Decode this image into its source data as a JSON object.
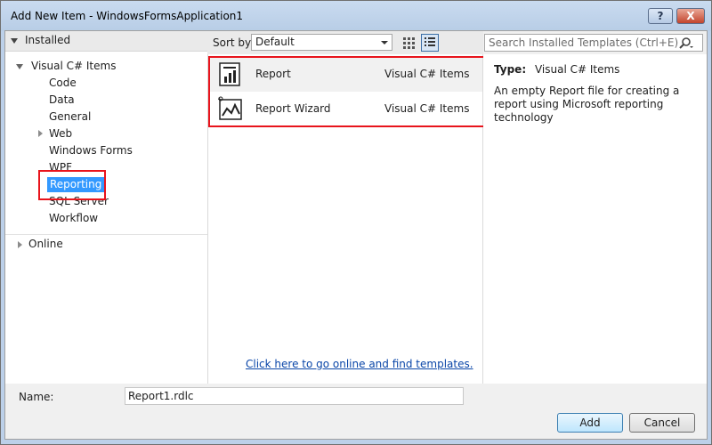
{
  "window": {
    "title": "Add New Item - WindowsFormsApplication1",
    "help_label": "?",
    "close_label": "X"
  },
  "tree": {
    "installed_label": "Installed",
    "root_label": "Visual C# Items",
    "children": [
      "Code",
      "Data",
      "General",
      "Web",
      "Windows Forms",
      "WPF",
      "Reporting",
      "SQL Server",
      "Workflow"
    ],
    "selected": "Reporting",
    "online_label": "Online"
  },
  "sort": {
    "label": "Sort by:",
    "value": "Default"
  },
  "search": {
    "placeholder": "Search Installed Templates (Ctrl+E)"
  },
  "templates": [
    {
      "name": "Report",
      "language": "Visual C# Items"
    },
    {
      "name": "Report Wizard",
      "language": "Visual C# Items"
    }
  ],
  "online_link": "Click here to go online and find templates.",
  "details": {
    "type_label": "Type:",
    "type_value": "Visual C# Items",
    "description": "An empty Report file for creating a report using Microsoft reporting technology"
  },
  "name_field": {
    "label": "Name:",
    "value": "Report1.rdlc"
  },
  "buttons": {
    "add": "Add",
    "cancel": "Cancel"
  },
  "colors": {
    "highlight": "#e8141c",
    "selection": "#3399ff",
    "link": "#0a46a8"
  }
}
